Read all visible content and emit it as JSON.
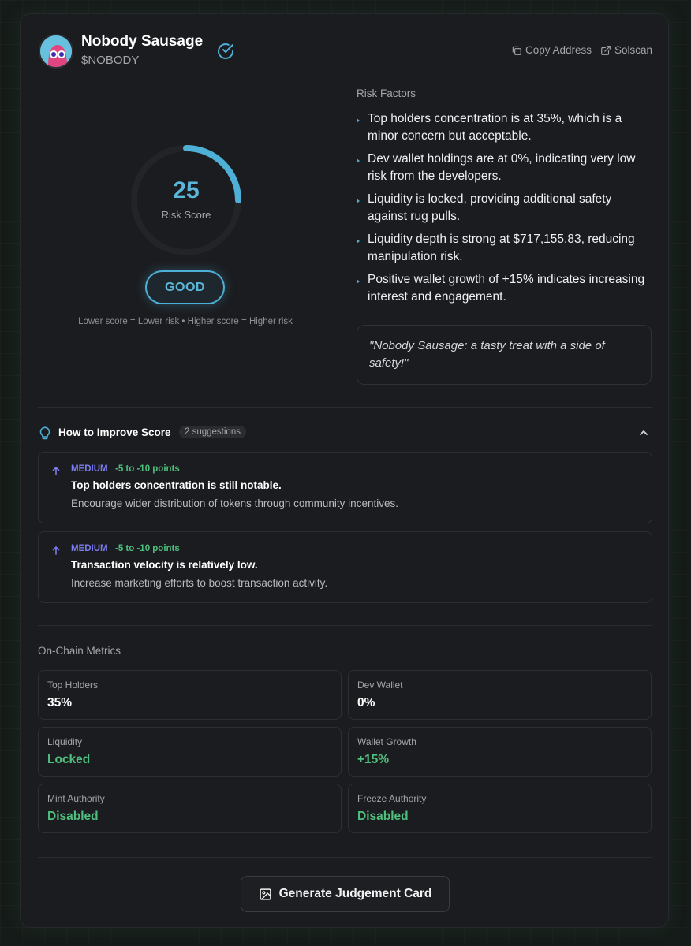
{
  "header": {
    "token_name": "Nobody Sausage",
    "ticker": "$NOBODY",
    "copy_address_label": "Copy Address",
    "solscan_label": "Solscan"
  },
  "score": {
    "value": "25",
    "label": "Risk Score",
    "fill_fraction": 0.25,
    "rating": "GOOD",
    "scale_note": "Lower score = Lower risk • Higher score = Higher risk",
    "accent_color": "#4eb0d6"
  },
  "risk_factors": {
    "title": "Risk Factors",
    "items": [
      "Top holders concentration is at 35%, which is a minor concern but acceptable.",
      "Dev wallet holdings are at 0%, indicating very low risk from the developers.",
      "Liquidity is locked, providing additional safety against rug pulls.",
      "Liquidity depth is strong at $717,155.83, reducing manipulation risk.",
      "Positive wallet growth of +15% indicates increasing interest and engagement."
    ],
    "quote": "\"Nobody Sausage: a tasty treat with a side of safety!\""
  },
  "improve": {
    "title": "How to Improve Score",
    "count": "2 suggestions",
    "suggestions": [
      {
        "level": "MEDIUM",
        "points": "-5 to -10 points",
        "title": "Top holders concentration is still notable.",
        "desc": "Encourage wider distribution of tokens through community incentives."
      },
      {
        "level": "MEDIUM",
        "points": "-5 to -10 points",
        "title": "Transaction velocity is relatively low.",
        "desc": "Increase marketing efforts to boost transaction activity."
      }
    ]
  },
  "metrics": {
    "title": "On-Chain Metrics",
    "items": [
      {
        "label": "Top Holders",
        "value": "35%"
      },
      {
        "label": "Dev Wallet",
        "value": "0%"
      },
      {
        "label": "Liquidity",
        "value": "Locked"
      },
      {
        "label": "Wallet Growth",
        "value": "+15%"
      },
      {
        "label": "Mint Authority",
        "value": "Disabled"
      },
      {
        "label": "Freeze Authority",
        "value": "Disabled"
      }
    ]
  },
  "generate_button": "Generate Judgement Card",
  "colors": {
    "green": "#4fbf7e",
    "medium": "#7b7cf0"
  }
}
